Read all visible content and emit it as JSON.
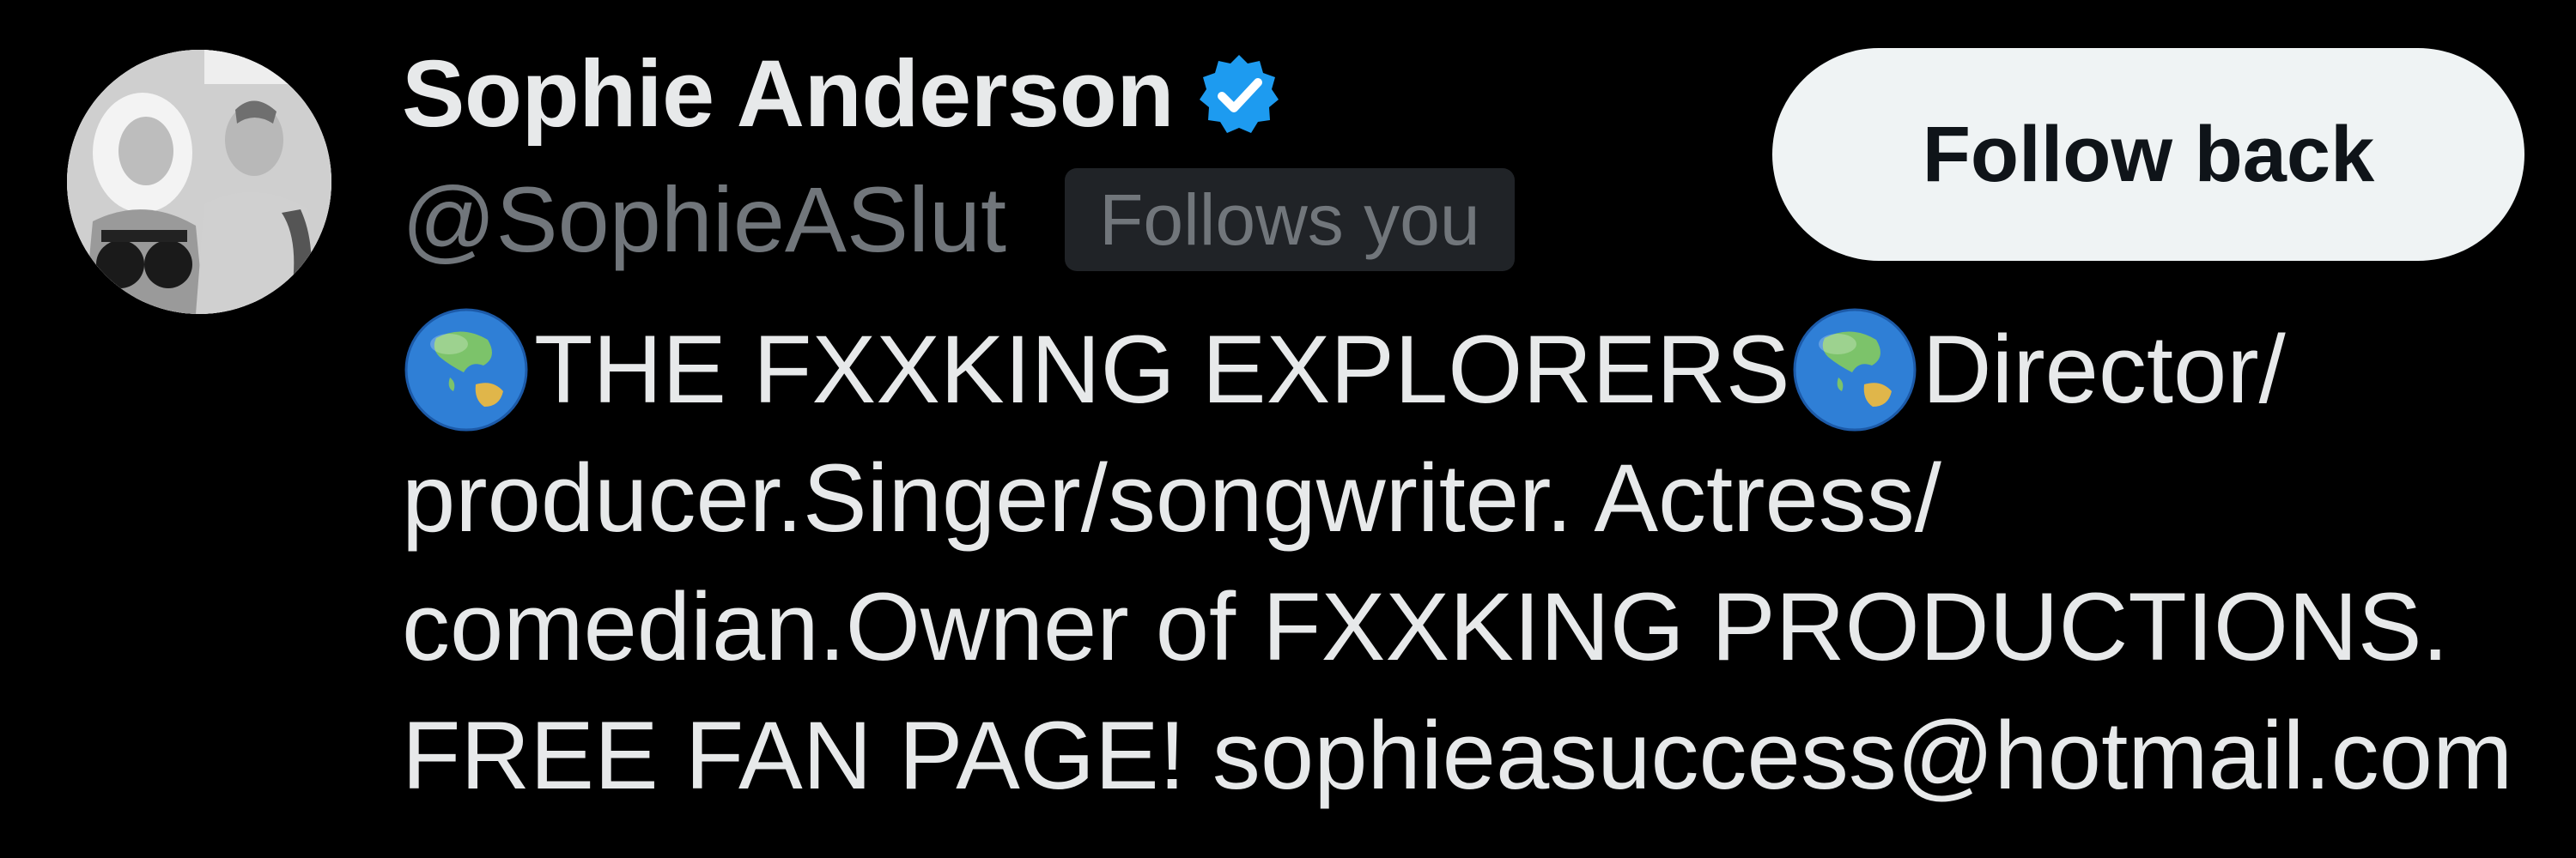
{
  "profile": {
    "display_name": "Sophie Anderson",
    "handle": "@SophieASlut",
    "follows_you_badge": "Follows you",
    "verified": true
  },
  "actions": {
    "follow_label": "Follow back"
  },
  "bio": {
    "line1_part1": "THE FXXKING EXPLORERS",
    "line1_part2": "Director/",
    "line2": "producer.Singer/songwriter. Actress/",
    "line3": "comedian.Owner of FXXKING PRODUCTIONS.",
    "line4": "FREE FAN PAGE! sophieasuccess@hotmail.com",
    "emoji": "globe-asia-australia"
  },
  "colors": {
    "background": "#000000",
    "primary_text": "#e7e9ea",
    "secondary_text": "#71767b",
    "badge_background": "#202327",
    "verified_blue": "#1d9bf0",
    "button_background": "#eff3f4",
    "button_text": "#0f1419"
  }
}
